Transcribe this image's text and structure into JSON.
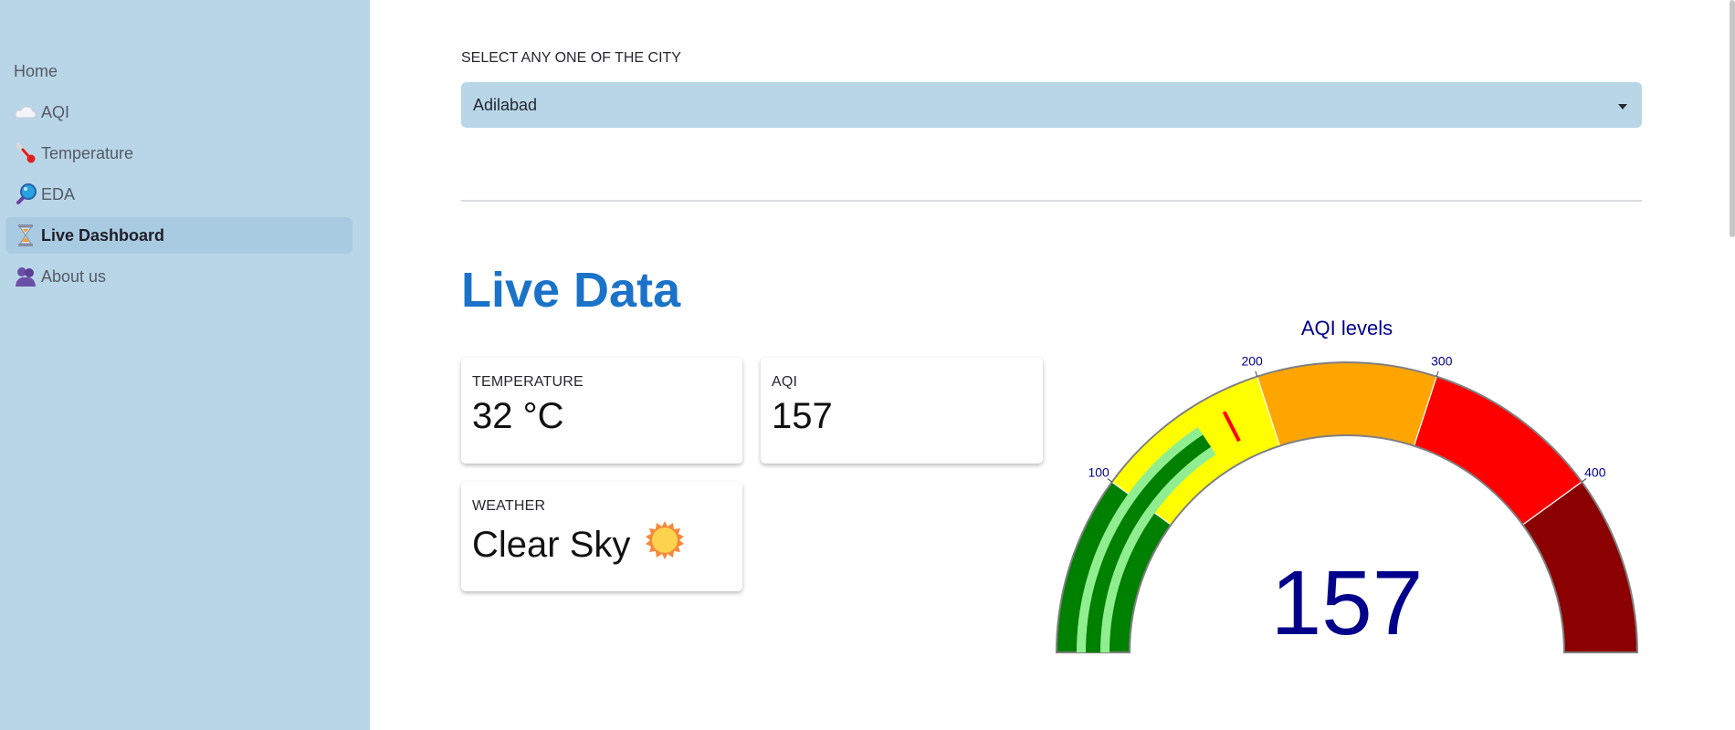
{
  "sidebar": {
    "items": [
      {
        "label": "Home",
        "icon": "none"
      },
      {
        "label": "AQI",
        "icon": "cloud-icon"
      },
      {
        "label": "Temperature",
        "icon": "thermometer-icon"
      },
      {
        "label": "EDA",
        "icon": "magnifier-icon"
      },
      {
        "label": "Live Dashboard",
        "icon": "hourglass-icon",
        "active": true
      },
      {
        "label": "About us",
        "icon": "people-icon"
      }
    ]
  },
  "city_select": {
    "label": "SELECT ANY ONE OF THE CITY",
    "value": "Adilabad"
  },
  "live": {
    "title": "Live Data",
    "temperature": {
      "label": "TEMPERATURE",
      "value": "32 °C"
    },
    "aqi": {
      "label": "AQI",
      "value": "157"
    },
    "weather": {
      "label": "WEATHER",
      "value": "Clear Sky",
      "icon": "sun-icon"
    }
  },
  "chart_data": {
    "type": "gauge",
    "title": "AQI levels",
    "value": 157,
    "value_text": "157",
    "threshold": 175,
    "range": [
      0,
      500
    ],
    "ticks": [
      {
        "value": 100,
        "label": "100"
      },
      {
        "value": 200,
        "label": "200"
      },
      {
        "value": 300,
        "label": "300"
      },
      {
        "value": 400,
        "label": "400"
      }
    ],
    "steps": [
      {
        "range": [
          0,
          100
        ],
        "color": "#008000"
      },
      {
        "range": [
          100,
          200
        ],
        "color": "#ffff00"
      },
      {
        "range": [
          200,
          300
        ],
        "color": "#ffa500"
      },
      {
        "range": [
          300,
          400
        ],
        "color": "#ff0000"
      },
      {
        "range": [
          400,
          500
        ],
        "color": "#8b0000"
      }
    ],
    "bar_color": "#008000",
    "bar_edge_color": "#90ee90",
    "threshold_color": "#ff0000",
    "text_color": "#00008b"
  }
}
